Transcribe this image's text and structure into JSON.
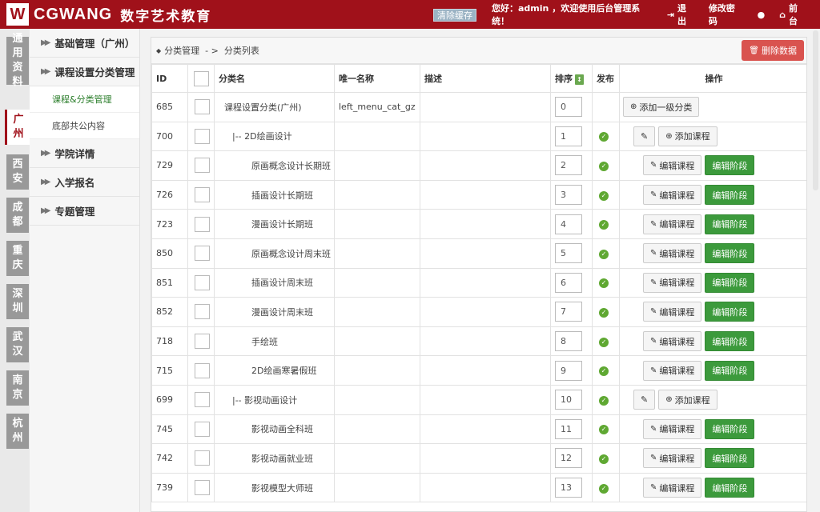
{
  "header": {
    "logo_mark": "W",
    "logo_text": "CGWANG",
    "logo_cn": "数字艺术教育",
    "cache_button": "清除缓存",
    "greeting": "您好：admin ，欢迎使用后台管理系统！",
    "logout": "退出",
    "change_password": "修改密码",
    "front": "前台"
  },
  "cities": [
    {
      "label": "通用资料"
    },
    {
      "label": "广州"
    },
    {
      "label": "西安"
    },
    {
      "label": "成都"
    },
    {
      "label": "重庆"
    },
    {
      "label": "深圳"
    },
    {
      "label": "武汉"
    },
    {
      "label": "南京"
    },
    {
      "label": "杭州"
    }
  ],
  "sidebar": {
    "groups": [
      {
        "label": "基础管理（广州）"
      },
      {
        "label": "课程设置分类管理"
      },
      {
        "label": "学院详情"
      },
      {
        "label": "入学报名"
      },
      {
        "label": "专题管理"
      }
    ],
    "subs": [
      {
        "label": "课程&分类管理"
      },
      {
        "label": "底部共公内容"
      }
    ]
  },
  "breadcrumb": {
    "root": "分类管理",
    "sep": "- >",
    "current": "分类列表"
  },
  "delete_button": "删除数据",
  "table": {
    "headers": {
      "id": "ID",
      "name": "分类名",
      "unique": "唯一名称",
      "desc": "描述",
      "sort": "排序",
      "publish": "发布",
      "ops": "操作"
    },
    "labels": {
      "add_top": "添加一级分类",
      "add_course": "添加课程",
      "edit_course": "编辑课程",
      "edit_stage": "编辑阶段"
    },
    "rows": [
      {
        "id": "685",
        "name": "课程设置分类(广州)",
        "unique": "left_menu_cat_gz",
        "sort": "0",
        "level": 1
      },
      {
        "id": "700",
        "name": "|-- 2D绘画设计",
        "unique": "",
        "sort": "1",
        "level": 2
      },
      {
        "id": "729",
        "name": "原画概念设计长期班",
        "unique": "",
        "sort": "2",
        "level": 3
      },
      {
        "id": "726",
        "name": "插画设计长期班",
        "unique": "",
        "sort": "3",
        "level": 3
      },
      {
        "id": "723",
        "name": "漫画设计长期班",
        "unique": "",
        "sort": "4",
        "level": 3
      },
      {
        "id": "850",
        "name": "原画概念设计周末班",
        "unique": "",
        "sort": "5",
        "level": 3
      },
      {
        "id": "851",
        "name": "插画设计周末班",
        "unique": "",
        "sort": "6",
        "level": 3
      },
      {
        "id": "852",
        "name": "漫画设计周末班",
        "unique": "",
        "sort": "7",
        "level": 3
      },
      {
        "id": "718",
        "name": "手绘班",
        "unique": "",
        "sort": "8",
        "level": 3
      },
      {
        "id": "715",
        "name": "2D绘画寒暑假班",
        "unique": "",
        "sort": "9",
        "level": 3
      },
      {
        "id": "699",
        "name": "|-- 影视动画设计",
        "unique": "",
        "sort": "10",
        "level": 2
      },
      {
        "id": "745",
        "name": "影视动画全科班",
        "unique": "",
        "sort": "11",
        "level": 3
      },
      {
        "id": "742",
        "name": "影视动画就业班",
        "unique": "",
        "sort": "12",
        "level": 3
      },
      {
        "id": "739",
        "name": "影视模型大师班",
        "unique": "",
        "sort": "13",
        "level": 3
      }
    ]
  }
}
